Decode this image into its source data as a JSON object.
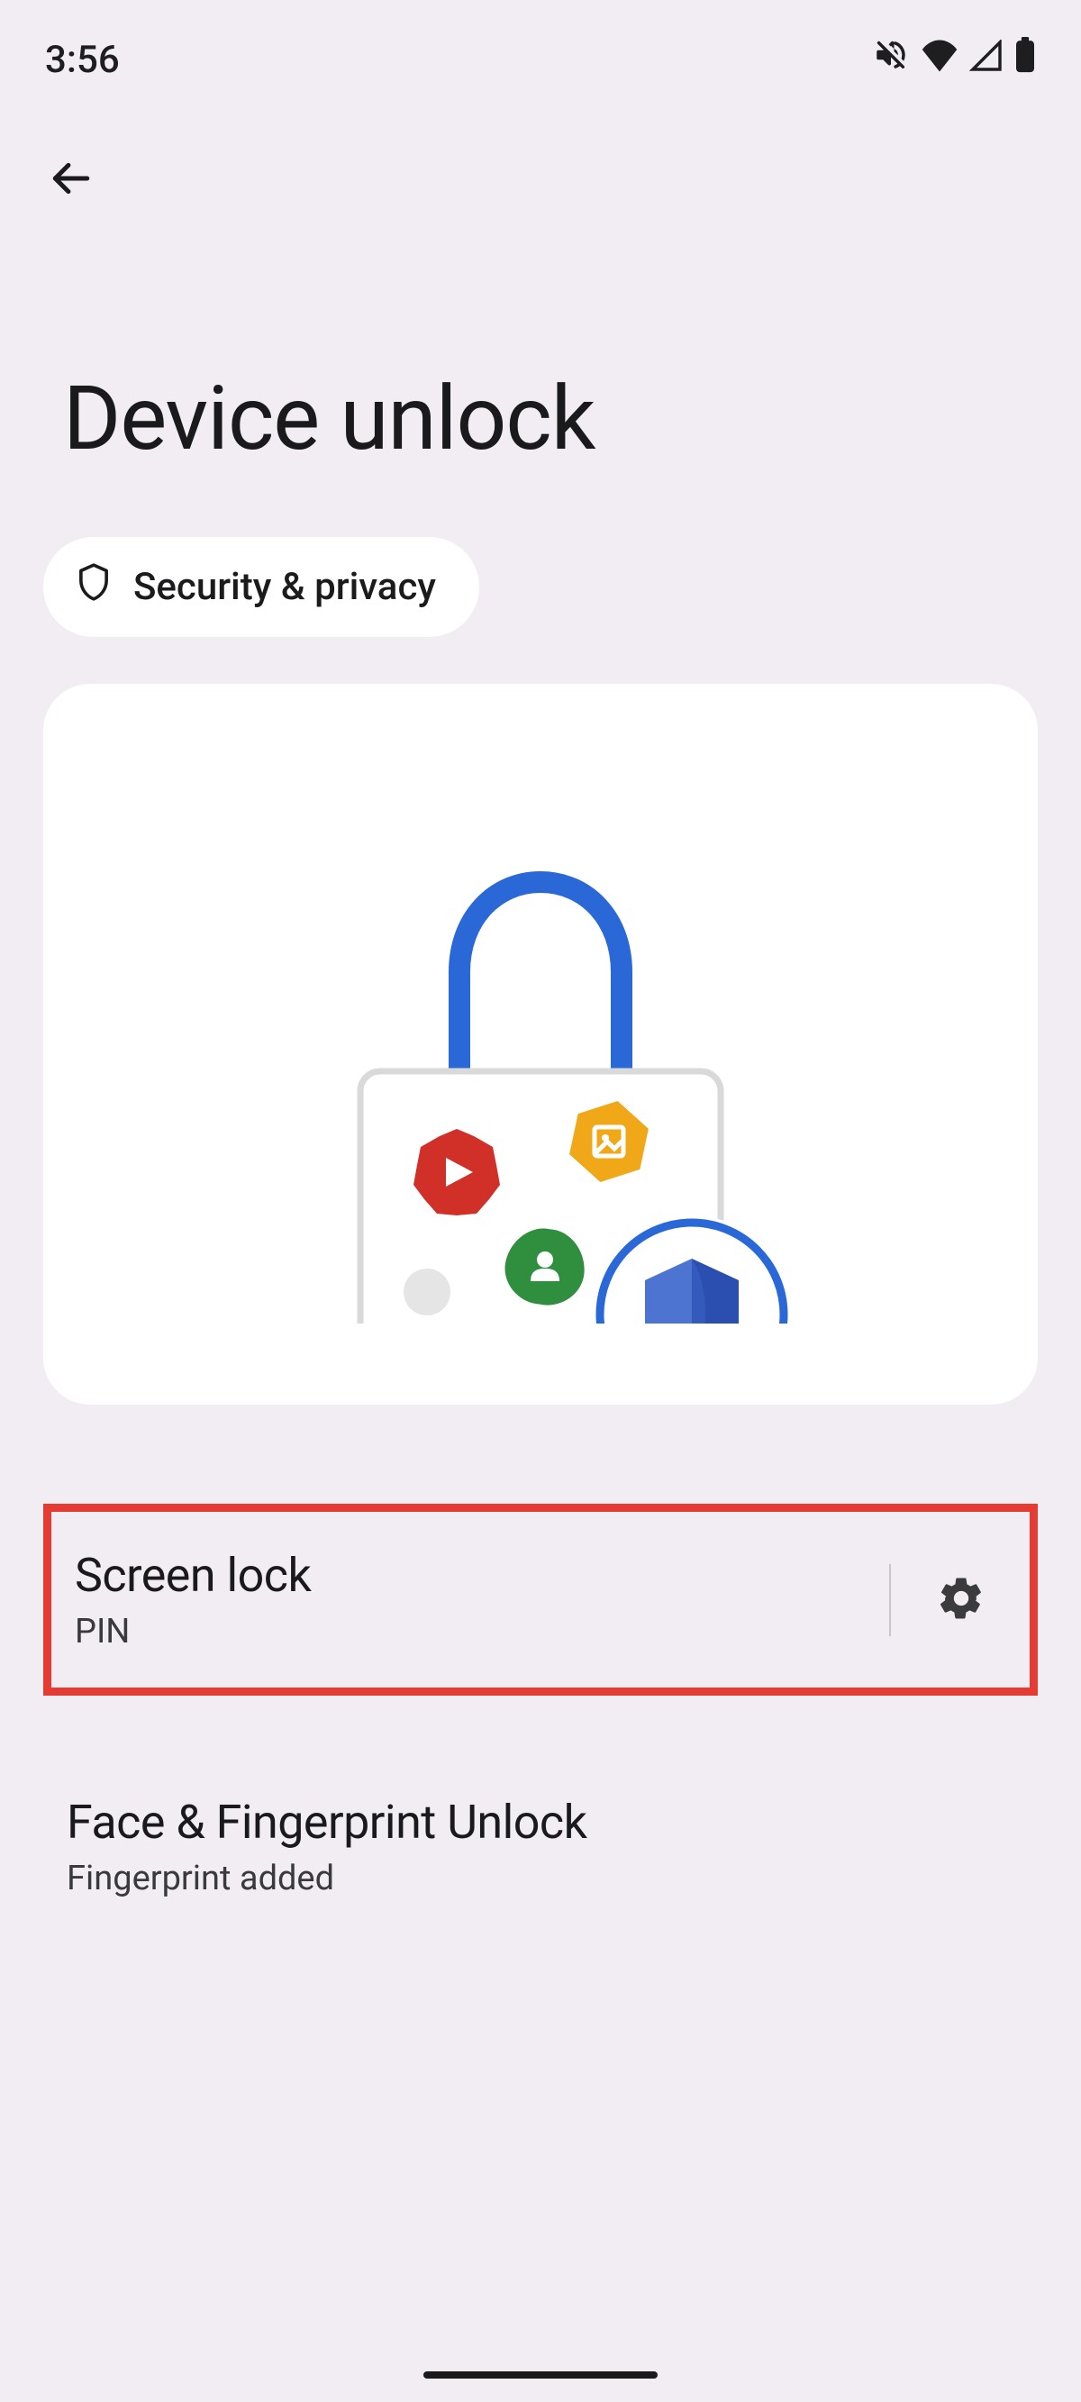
{
  "statusBar": {
    "time": "3:56"
  },
  "header": {
    "title": "Device unlock"
  },
  "chip": {
    "label": "Security & privacy"
  },
  "items": [
    {
      "title": "Screen lock",
      "subtitle": "PIN",
      "highlighted": true,
      "hasGear": true
    },
    {
      "title": "Face & Fingerprint Unlock",
      "subtitle": "Fingerprint added",
      "highlighted": false,
      "hasGear": false
    }
  ],
  "colors": {
    "background": "#f1edf2",
    "card": "#ffffff",
    "highlightBorder": "#e43c32",
    "text": "#1a1a1d",
    "subtext": "#3a3a3d"
  }
}
